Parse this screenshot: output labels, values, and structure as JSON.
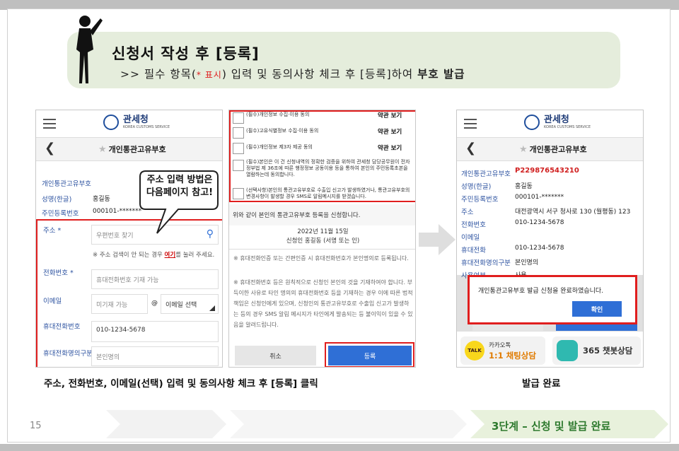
{
  "header": {
    "title": "신청서 작성 후 [등록]",
    "sub_prefix": ">>  필수 항목(",
    "sub_req": "* 표시",
    "sub_middle": ") 입력 및  동의사항  체크 후 [등록]하여 ",
    "sub_bold": "부호 발급"
  },
  "phone_common": {
    "org_name": "관세청",
    "org_en": "KOREA CUSTOMS SERVICE",
    "page_title": "개인통관고유부호"
  },
  "phone1": {
    "rows": [
      {
        "label": "개인통관고유부호",
        "value": ""
      },
      {
        "label": "성명(한글)",
        "value": "홍길동"
      },
      {
        "label": "주민등록번호",
        "value": "000101-*******"
      }
    ],
    "callout": "주소 입력 방법은\n다음페이지 참고!",
    "address_label": "주소 *",
    "zip_placeholder": "우편번호 찾기",
    "address_note_prefix": "※ 주소 검색이 안 되는 경우 ",
    "address_note_link": "여기",
    "address_note_suffix": "를 눌러 주세요.",
    "phone_label": "전화번호 *",
    "phone_placeholder": "휴대전화번호 기재 가능",
    "email_label": "이메일",
    "email_placeholder": "미기재 가능",
    "email_at": "@",
    "email_select": "이메일 선택",
    "mobile_label": "휴대전화번호",
    "mobile_value": "010-1234-5678",
    "mobile_name_label": "휴대전화명의구분",
    "mobile_name_value": "본인명의"
  },
  "phone2": {
    "agreements": [
      {
        "text": "(필수)개인정보 수집·이용 동의",
        "link": "약관 보기"
      },
      {
        "text": "(필수)고유식별정보 수집·이용 동의",
        "link": "약관 보기"
      },
      {
        "text": "(필수)개인정보 제3자 제공 동의",
        "link": "약관 보기"
      },
      {
        "text": "(필수)본인은 이 건 신청내역의 정확한 검증을 위하여 관세청 담당공무원이 전자정부법 제 36조에 따른 행정정보 공동이용 등을 통하여 본인의 주민등록초본을 열람하는데 동의합니다.",
        "link": ""
      },
      {
        "text": "(선택사항)본인의 통관고유부호로 수출입 신고가 발생하였거나, 통관고유부호의 변경사항이 발생할 경우 SMS로 알림메시지를 받겠습니다.",
        "link": ""
      }
    ],
    "confirm_text": "위와 같이 본인의 통관고유부호 등록을 신청합니다.",
    "date": "2022년 11월 15일",
    "signer": "신청인 홍길동 (서명 또는 인)",
    "notes": [
      "※ 휴대전화인증 또는 간편인증 시 휴대전화번호가 본인명의로 등록됩니다.",
      "※ 휴대전화번호 등은 원칙적으로 신청인 본인의 것을 기재하여야 합니다. 부득이한 사유로 타인 명의의 휴대전화번호 등을 기재하는 경우 이에 따른 법적 책임은 신청인에게 있으며, 신청인의 통관고유부호로 수출입 신고가 발생하는 등의 경우 SMS 알림 메시지가 타인에게 발송되는 등 불이익이 있을 수 있음을 알려드립니다."
    ],
    "cancel": "취소",
    "submit": "등록"
  },
  "phone3": {
    "rows": [
      {
        "label": "개인통관고유부호",
        "value": "P229876543210"
      },
      {
        "label": "성명(한글)",
        "value": "홍길동"
      },
      {
        "label": "주민등록번호",
        "value": "000101-*******"
      },
      {
        "label": "주소",
        "value": "대전광역시 서구 청사로 130 (월평동) 123"
      },
      {
        "label": "전화번호",
        "value": "010-1234-5678"
      },
      {
        "label": "이메일",
        "value": ""
      },
      {
        "label": "휴대전화",
        "value": "010-1234-5678"
      },
      {
        "label": "휴대전화명의구분",
        "value": "본인명의"
      },
      {
        "label": "사용여부",
        "value": "사용"
      }
    ],
    "dialog_message": "개인통관고유부호 발급 신청을 완료하였습니다.",
    "dialog_ok": "확인",
    "kakao_top": "카카오톡",
    "kakao_bottom": "1:1 채팅상담",
    "chatbot": "365 챗봇상담"
  },
  "captions": {
    "left": "주소, 전화번호, 이메일(선택) 입력  및  동의사항 체크 후 [등록] 클릭",
    "right": "발급 완료"
  },
  "footer": {
    "page": "15",
    "step": "3단계 – 신청 및 발급 완료"
  },
  "colors": {
    "highlight_red": "#e01e1e",
    "label_blue": "#2c52a0",
    "button_blue": "#2f6fd6",
    "title_bg": "#e5eddc",
    "footer_green": "#2e7a2e"
  }
}
